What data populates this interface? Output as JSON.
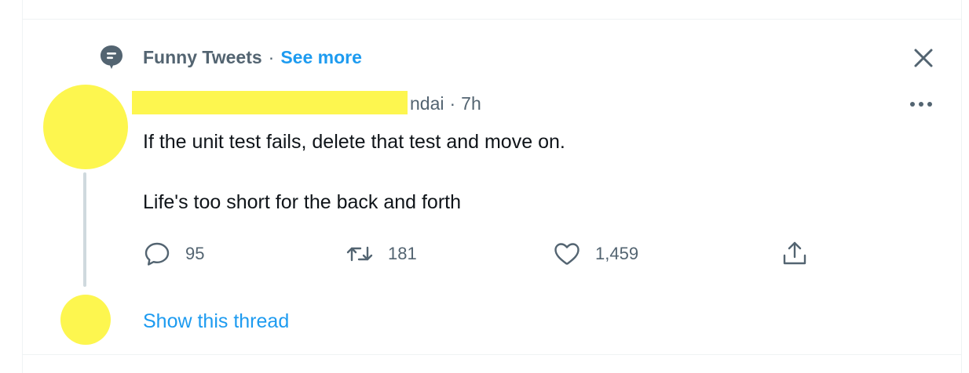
{
  "social_context": {
    "topic": "Funny Tweets",
    "separator": "·",
    "see_more": "See more",
    "icon": "topic-icon"
  },
  "tweet": {
    "handle_visible": "ndai",
    "separator": "·",
    "time": "7h",
    "text_line1": "If the unit test fails, delete that test and move on.",
    "text_line2": "Life's too short for the back and forth",
    "actions": {
      "reply_count": "95",
      "retweet_count": "181",
      "like_count": "1,459"
    }
  },
  "show_thread": "Show this thread",
  "colors": {
    "accent": "#1d9bf0",
    "secondary_text": "#536471",
    "primary_text": "#0f1419",
    "redaction": "#fdf64f",
    "thread_line": "#cfd9de"
  },
  "icons": {
    "close": "close-icon",
    "more": "more-icon",
    "reply": "reply-icon",
    "retweet": "retweet-icon",
    "like": "heart-icon",
    "share": "share-icon"
  }
}
